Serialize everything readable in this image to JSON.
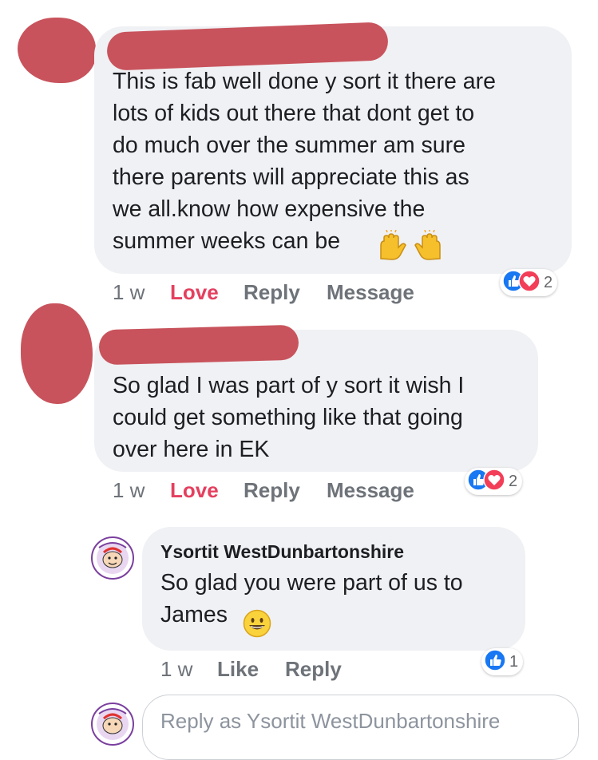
{
  "comments": [
    {
      "text": "This is fab well done y sort it there are\nlots of kids out there that dont get to\ndo much over the summer am sure\nthere parents will appreciate this as\nwe all.know how expensive the\nsummer weeks can be",
      "emoji": "raised-hands",
      "time": "1 w",
      "reacted": "Love",
      "reply": "Reply",
      "message": "Message",
      "reaction_count": "2"
    },
    {
      "text": "So glad I was part of y sort it wish I\ncould get something like that going\nover here in EK",
      "time": "1 w",
      "reacted": "Love",
      "reply": "Reply",
      "message": "Message",
      "reaction_count": "2"
    }
  ],
  "reply": {
    "author": "Ysortit WestDunbartonshire",
    "text": "So glad you were part of us to\nJames",
    "emoji": "grinning-face",
    "time": "1 w",
    "like": "Like",
    "reply": "Reply",
    "reaction_count": "1"
  },
  "composer": {
    "placeholder": "Reply as Ysortit WestDunbartonshire"
  },
  "colors": {
    "bubble": "#f0f1f4",
    "love": "#e4405f",
    "like_blue": "#1877f2",
    "heart_red": "#f33e58",
    "redaction": "#c8535c"
  }
}
